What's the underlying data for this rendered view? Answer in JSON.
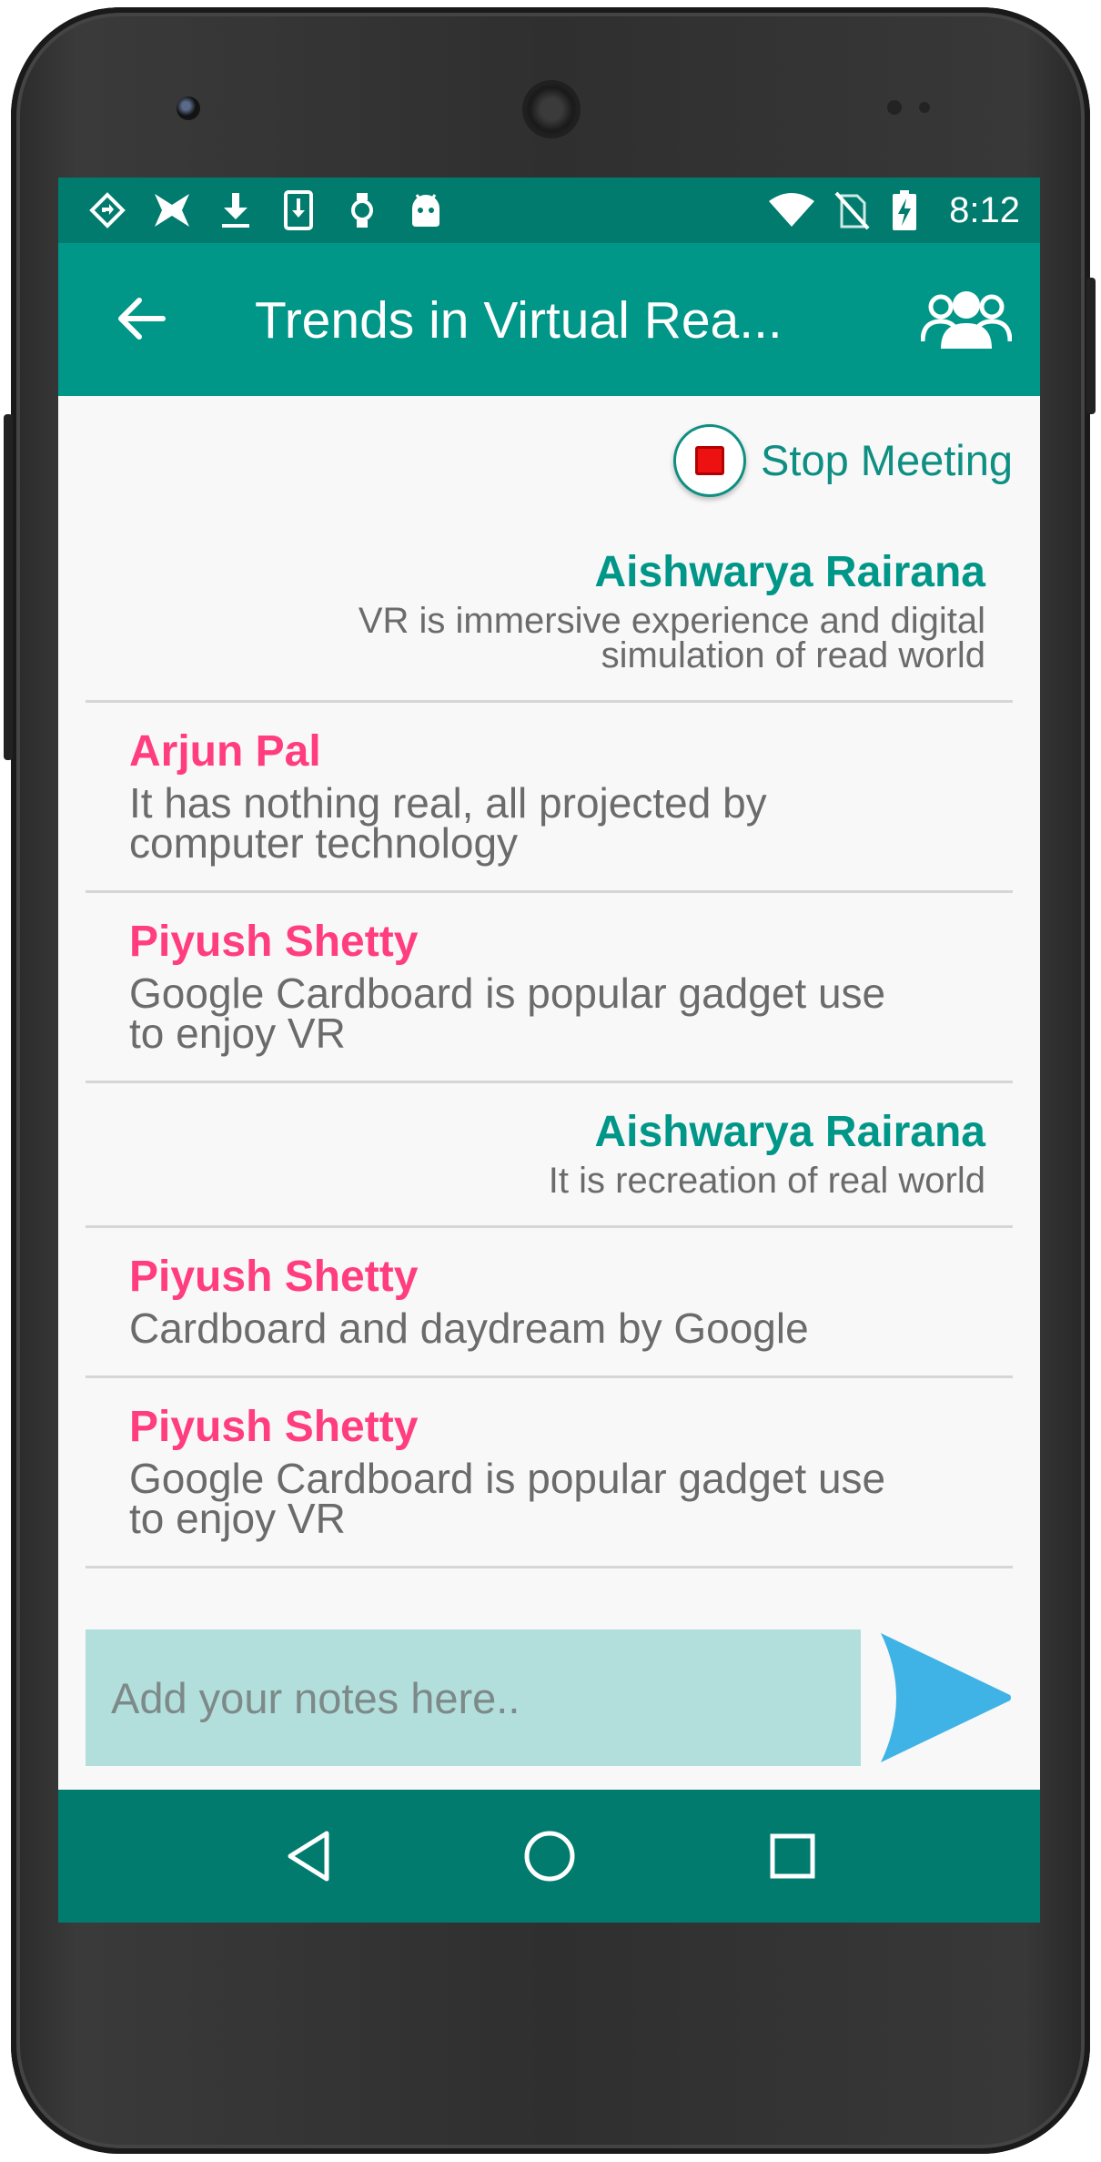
{
  "status_bar": {
    "time": "8:12",
    "left_icons": [
      "navigation-diamond-icon",
      "bowtie-icon",
      "download-icon",
      "sd-download-icon",
      "watch-icon",
      "android-icon"
    ],
    "right_icons": [
      "wifi-icon",
      "no-sim-icon",
      "battery-charging-icon"
    ]
  },
  "app_bar": {
    "title": "Trends in Virtual Rea...",
    "back_icon": "arrow-left-icon",
    "participants_icon": "group-icon"
  },
  "meeting": {
    "stop_label": "Stop Meeting"
  },
  "messages": [
    {
      "author": "Aishwarya Rairana",
      "text": "VR is immersive experience and digital simulation of read world",
      "align": "right"
    },
    {
      "author": "Arjun Pal",
      "text": "It has nothing real, all projected by computer technology",
      "align": "left"
    },
    {
      "author": "Piyush Shetty",
      "text": "Google Cardboard is popular gadget use to enjoy VR",
      "align": "left"
    },
    {
      "author": "Aishwarya Rairana",
      "text": "It is recreation of real world",
      "align": "right"
    },
    {
      "author": "Piyush Shetty",
      "text": "Cardboard and daydream by Google",
      "align": "left"
    },
    {
      "author": "Piyush Shetty",
      "text": "Google Cardboard is popular gadget use to enjoy VR",
      "align": "left"
    }
  ],
  "composer": {
    "placeholder": "Add your notes here..",
    "send_icon": "send-arrow-icon"
  },
  "colors": {
    "status_bar": "#007b6e",
    "app_bar": "#009688",
    "own_author": "#009688",
    "other_author": "#ff3d7f",
    "input_bg": "#b2dfdb",
    "send": "#3fb3e6"
  }
}
